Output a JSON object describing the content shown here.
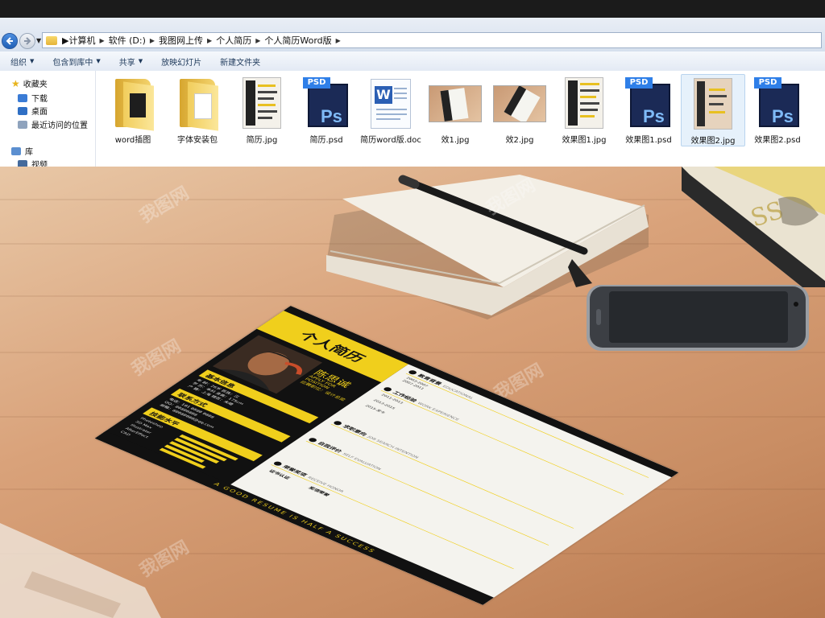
{
  "explorer": {
    "path": [
      "计算机",
      "软件 (D:)",
      "我图网上传",
      "个人简历",
      "个人简历Word版"
    ],
    "toolbar": [
      "组织",
      "包含到库中",
      "共享",
      "放映幻灯片",
      "新建文件夹"
    ],
    "nav": {
      "favorites": "收藏夹",
      "downloads": "下载",
      "desktop": "桌面",
      "recent": "最近访问的位置",
      "libraries": "库",
      "videos": "视频"
    },
    "files": [
      {
        "name": "word插图",
        "kind": "folder"
      },
      {
        "name": "字体安装包",
        "kind": "folder"
      },
      {
        "name": "简历.jpg",
        "kind": "jpg"
      },
      {
        "name": "简历.psd",
        "kind": "psd"
      },
      {
        "name": "简历word版.doc",
        "kind": "doc"
      },
      {
        "name": "效1.jpg",
        "kind": "photo"
      },
      {
        "name": "效2.jpg",
        "kind": "photo"
      },
      {
        "name": "效果图1.jpg",
        "kind": "jpg"
      },
      {
        "name": "效果图1.psd",
        "kind": "psd"
      },
      {
        "name": "效果图2.jpg",
        "kind": "jpg",
        "selected": true
      },
      {
        "name": "效果图2.psd",
        "kind": "psd"
      }
    ],
    "psd_tag": "PSD",
    "psd_letters": "Ps",
    "word_letter": "W"
  },
  "resume": {
    "title": "个人简历",
    "name": "陈思诚",
    "position_en": "APPLY FOR POSITION",
    "position_cn": "应聘职位：设计总监",
    "sections_left": [
      "基本信息",
      "联系方式",
      "技能水平"
    ],
    "basic_info": [
      "年 龄：26岁   民族：汉",
      "学 历：本科   身高：175cm",
      "户 籍：上海   婚否：未婚"
    ],
    "contact": [
      "电话：181 8888 8888",
      "QQ：88888888",
      "邮箱：88888888@qq.com"
    ],
    "skills": [
      "Photoshop",
      "3D Max",
      "Illustrator",
      "AfterEffect",
      "CAD"
    ],
    "skill_levels": [
      0.9,
      0.8,
      0.75,
      0.6,
      0.7
    ],
    "main_sections": [
      {
        "cn": "教育背景",
        "en": "EDUCATIONAL"
      },
      {
        "cn": "工作经验",
        "en": "WORK EXPERIENCE"
      },
      {
        "cn": "求职意向",
        "en": "JOB SEARCH INTENTION"
      },
      {
        "cn": "自我评价",
        "en": "SELF EVALUATION"
      },
      {
        "cn": "荣誉奖项",
        "en": "RECEIVE HONOR"
      }
    ],
    "edu_years": [
      "2003-2007",
      "2007-2011"
    ],
    "work_years": [
      "2011-2013",
      "2013-2015",
      "2015-至今"
    ],
    "cert_label": "证书认证",
    "award_label": "奖项荣誉",
    "footer": "A GOOD RESUME IS HALF A SUCCESS"
  },
  "watermark": "我图网",
  "colors": {
    "accent": "#f0cf1c",
    "dark": "#111111",
    "paper": "#f4f3ee"
  }
}
